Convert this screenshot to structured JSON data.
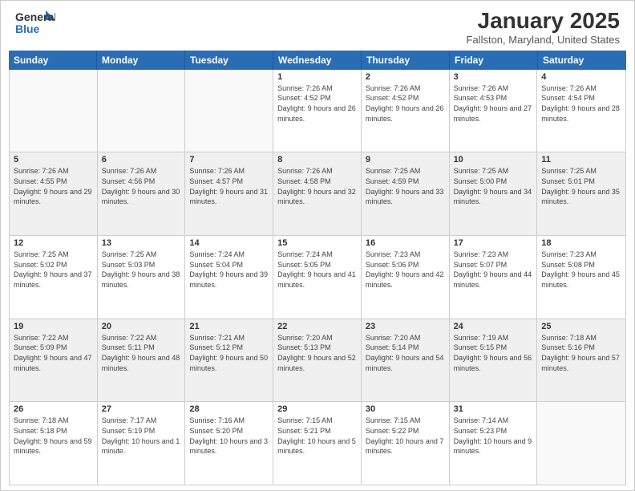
{
  "logo": {
    "general": "General",
    "blue": "Blue"
  },
  "title": "January 2025",
  "location": "Fallston, Maryland, United States",
  "days_of_week": [
    "Sunday",
    "Monday",
    "Tuesday",
    "Wednesday",
    "Thursday",
    "Friday",
    "Saturday"
  ],
  "weeks": [
    [
      {
        "day": "",
        "info": ""
      },
      {
        "day": "",
        "info": ""
      },
      {
        "day": "",
        "info": ""
      },
      {
        "day": "1",
        "info": "Sunrise: 7:26 AM\nSunset: 4:52 PM\nDaylight: 9 hours and 26 minutes."
      },
      {
        "day": "2",
        "info": "Sunrise: 7:26 AM\nSunset: 4:52 PM\nDaylight: 9 hours and 26 minutes."
      },
      {
        "day": "3",
        "info": "Sunrise: 7:26 AM\nSunset: 4:53 PM\nDaylight: 9 hours and 27 minutes."
      },
      {
        "day": "4",
        "info": "Sunrise: 7:26 AM\nSunset: 4:54 PM\nDaylight: 9 hours and 28 minutes."
      }
    ],
    [
      {
        "day": "5",
        "info": "Sunrise: 7:26 AM\nSunset: 4:55 PM\nDaylight: 9 hours and 29 minutes."
      },
      {
        "day": "6",
        "info": "Sunrise: 7:26 AM\nSunset: 4:56 PM\nDaylight: 9 hours and 30 minutes."
      },
      {
        "day": "7",
        "info": "Sunrise: 7:26 AM\nSunset: 4:57 PM\nDaylight: 9 hours and 31 minutes."
      },
      {
        "day": "8",
        "info": "Sunrise: 7:26 AM\nSunset: 4:58 PM\nDaylight: 9 hours and 32 minutes."
      },
      {
        "day": "9",
        "info": "Sunrise: 7:25 AM\nSunset: 4:59 PM\nDaylight: 9 hours and 33 minutes."
      },
      {
        "day": "10",
        "info": "Sunrise: 7:25 AM\nSunset: 5:00 PM\nDaylight: 9 hours and 34 minutes."
      },
      {
        "day": "11",
        "info": "Sunrise: 7:25 AM\nSunset: 5:01 PM\nDaylight: 9 hours and 35 minutes."
      }
    ],
    [
      {
        "day": "12",
        "info": "Sunrise: 7:25 AM\nSunset: 5:02 PM\nDaylight: 9 hours and 37 minutes."
      },
      {
        "day": "13",
        "info": "Sunrise: 7:25 AM\nSunset: 5:03 PM\nDaylight: 9 hours and 38 minutes."
      },
      {
        "day": "14",
        "info": "Sunrise: 7:24 AM\nSunset: 5:04 PM\nDaylight: 9 hours and 39 minutes."
      },
      {
        "day": "15",
        "info": "Sunrise: 7:24 AM\nSunset: 5:05 PM\nDaylight: 9 hours and 41 minutes."
      },
      {
        "day": "16",
        "info": "Sunrise: 7:23 AM\nSunset: 5:06 PM\nDaylight: 9 hours and 42 minutes."
      },
      {
        "day": "17",
        "info": "Sunrise: 7:23 AM\nSunset: 5:07 PM\nDaylight: 9 hours and 44 minutes."
      },
      {
        "day": "18",
        "info": "Sunrise: 7:23 AM\nSunset: 5:08 PM\nDaylight: 9 hours and 45 minutes."
      }
    ],
    [
      {
        "day": "19",
        "info": "Sunrise: 7:22 AM\nSunset: 5:09 PM\nDaylight: 9 hours and 47 minutes."
      },
      {
        "day": "20",
        "info": "Sunrise: 7:22 AM\nSunset: 5:11 PM\nDaylight: 9 hours and 48 minutes."
      },
      {
        "day": "21",
        "info": "Sunrise: 7:21 AM\nSunset: 5:12 PM\nDaylight: 9 hours and 50 minutes."
      },
      {
        "day": "22",
        "info": "Sunrise: 7:20 AM\nSunset: 5:13 PM\nDaylight: 9 hours and 52 minutes."
      },
      {
        "day": "23",
        "info": "Sunrise: 7:20 AM\nSunset: 5:14 PM\nDaylight: 9 hours and 54 minutes."
      },
      {
        "day": "24",
        "info": "Sunrise: 7:19 AM\nSunset: 5:15 PM\nDaylight: 9 hours and 56 minutes."
      },
      {
        "day": "25",
        "info": "Sunrise: 7:18 AM\nSunset: 5:16 PM\nDaylight: 9 hours and 57 minutes."
      }
    ],
    [
      {
        "day": "26",
        "info": "Sunrise: 7:18 AM\nSunset: 5:18 PM\nDaylight: 9 hours and 59 minutes."
      },
      {
        "day": "27",
        "info": "Sunrise: 7:17 AM\nSunset: 5:19 PM\nDaylight: 10 hours and 1 minute."
      },
      {
        "day": "28",
        "info": "Sunrise: 7:16 AM\nSunset: 5:20 PM\nDaylight: 10 hours and 3 minutes."
      },
      {
        "day": "29",
        "info": "Sunrise: 7:15 AM\nSunset: 5:21 PM\nDaylight: 10 hours and 5 minutes."
      },
      {
        "day": "30",
        "info": "Sunrise: 7:15 AM\nSunset: 5:22 PM\nDaylight: 10 hours and 7 minutes."
      },
      {
        "day": "31",
        "info": "Sunrise: 7:14 AM\nSunset: 5:23 PM\nDaylight: 10 hours and 9 minutes."
      },
      {
        "day": "",
        "info": ""
      }
    ]
  ]
}
